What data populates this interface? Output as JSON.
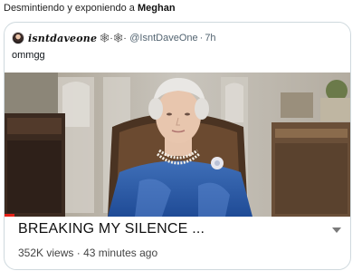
{
  "header": {
    "prefix": "Desmintiendo y exponiendo a ",
    "name": "Meghan"
  },
  "quoted_tweet": {
    "display_name": "𝒊𝒔𝒏𝒕𝒅𝒂𝒗𝒆𝒐𝒏𝒆",
    "emoji": "🕸·🕸·",
    "handle": "@IsntDaveOne",
    "separator": "·",
    "time": "7h",
    "text": "ommgg"
  },
  "video": {
    "title": "BREAKING MY SILENCE ...",
    "views": "352K views",
    "separator": "·",
    "age": "43 minutes ago",
    "progress": 0.03
  },
  "icons": {
    "avatar": "avatar-image",
    "menu": "chevron-down-icon"
  },
  "colors": {
    "progress": "#e62117",
    "handle": "#536471"
  }
}
